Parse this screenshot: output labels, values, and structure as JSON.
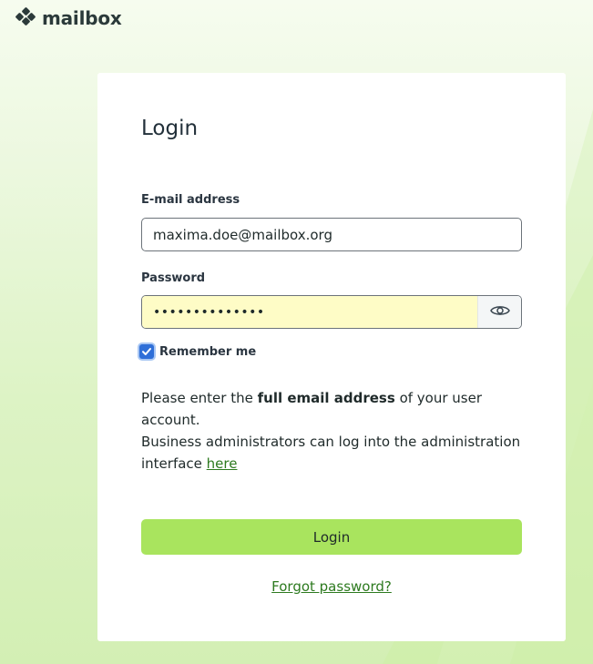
{
  "brand": {
    "name": "mailbox",
    "icon": "mailbox-logo-icon",
    "accent": "#a9e45e",
    "link_color": "#2d7a1f"
  },
  "login": {
    "title": "Login",
    "email_label": "E-mail address",
    "email_value": "maxima.doe@mailbox.org",
    "password_label": "Password",
    "password_masked": "••••••••••••••",
    "show_password_icon": "eye-icon",
    "remember_label": "Remember me",
    "remember_checked": true,
    "note1_prefix": "Please enter the ",
    "note1_bold": "full email address",
    "note1_suffix": " of your user account.",
    "note2_text": "Business administrators can log into the administration interface ",
    "note2_link": "here",
    "submit_label": "Login",
    "forgot_label": "Forgot password?"
  }
}
